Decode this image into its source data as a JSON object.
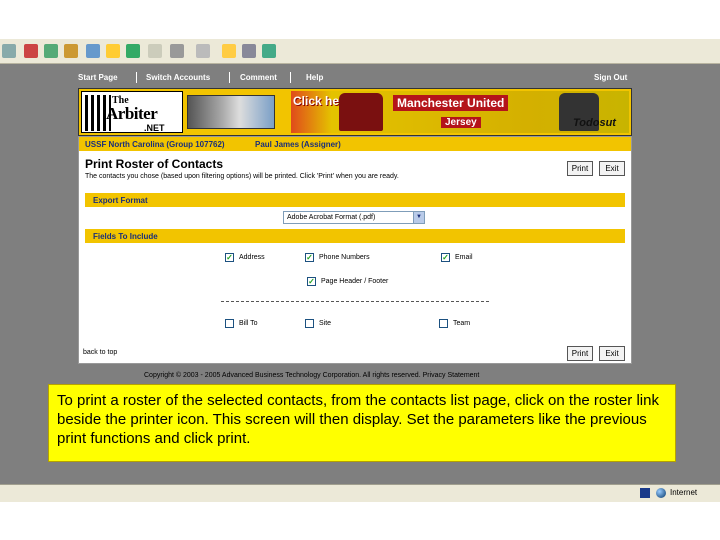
{
  "colors": {
    "accent": "#f2c400",
    "page_bg": "#7f7f7f",
    "caption_bg": "#ffff00",
    "link_blue": "#1a2f7a"
  },
  "navbar": {
    "items": [
      "Start Page",
      "Switch Accounts",
      "Comment",
      "Help"
    ],
    "sign_out": "Sign Out"
  },
  "banner": {
    "logo_the": "The",
    "logo_arbiter": "Arbiter",
    "logo_net": ".NET",
    "ad_click": "Click here!",
    "ad_title": "Manchester United",
    "ad_jersey": "Jersey",
    "ad_brand": "Todosut"
  },
  "account": {
    "org": "USSF North Carolina (Group 107762)",
    "user": "Paul James (Assigner)"
  },
  "main": {
    "title": "Print Roster of Contacts",
    "instructions": "The contacts you chose (based upon filtering options) will be printed. Click 'Print' when you are ready.",
    "print_label": "Print",
    "exit_label": "Exit",
    "export_section": "Export Format",
    "export_value": "Adobe Acrobat Format (.pdf)",
    "fields_section": "Fields To Include",
    "fields": [
      {
        "label": "Address",
        "checked": true
      },
      {
        "label": "Phone Numbers",
        "checked": true
      },
      {
        "label": "Email",
        "checked": true
      },
      {
        "label": "Page Header / Footer",
        "checked": true
      },
      {
        "label": "Bill To",
        "checked": false
      },
      {
        "label": "Site",
        "checked": false
      },
      {
        "label": "Team",
        "checked": false
      }
    ],
    "back_to_top": "back to top"
  },
  "copyright": "Copyright © 2003 - 2005 Advanced Business Technology Corporation. All rights reserved. Privacy Statement",
  "caption": "To print a roster of the selected contacts, from the contacts list page, click on the roster link beside the printer icon. This screen will then display. Set the parameters like the previous print functions and click print.",
  "status": {
    "zone": "Internet"
  },
  "icons": [
    "back-icon",
    "stop-icon",
    "home-icon",
    "search-icon",
    "favorites-icon",
    "media-icon",
    "mail-icon",
    "print-icon",
    "edit-icon",
    "folder-icon",
    "messenger-icon",
    "globe-icon"
  ]
}
